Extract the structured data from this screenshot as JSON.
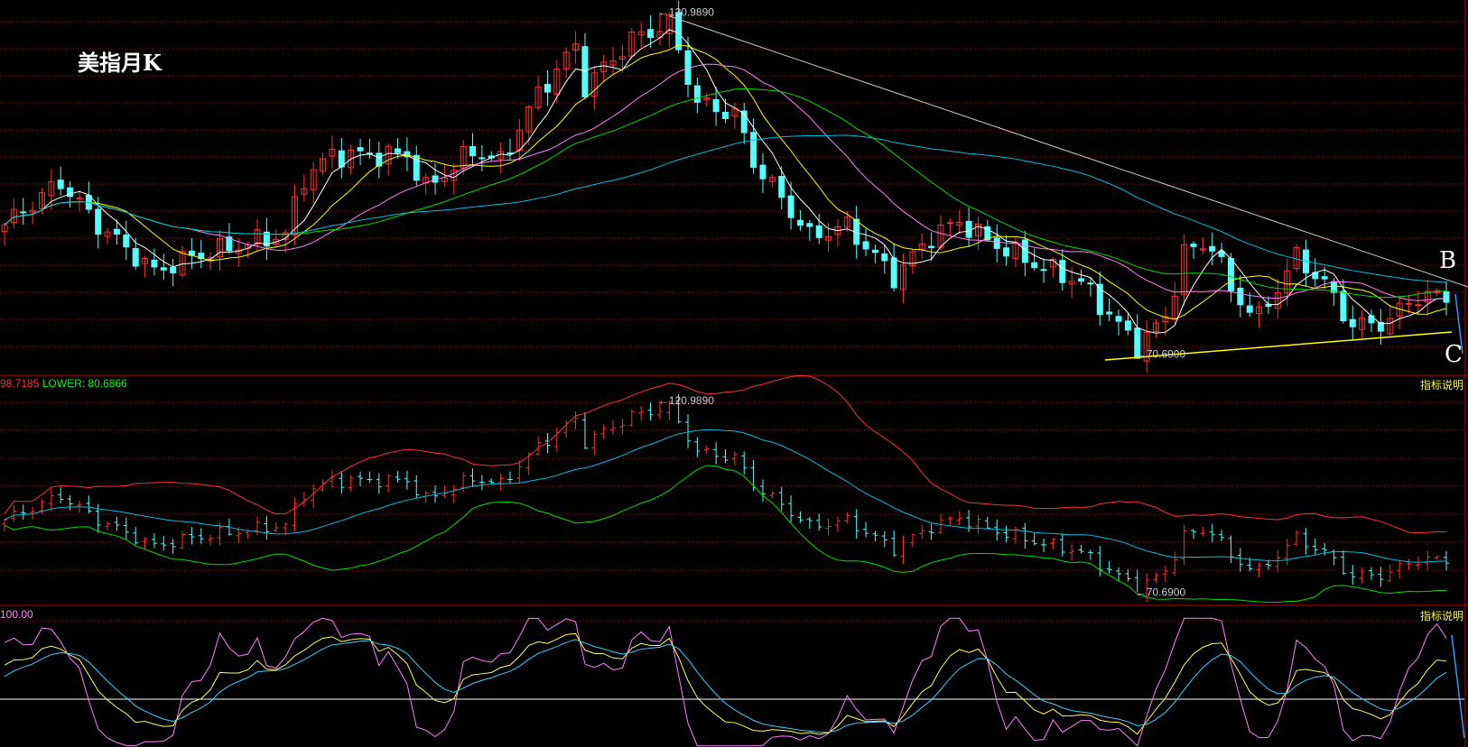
{
  "title": "美指月K",
  "help_label": "指标说明",
  "wave_labels": {
    "b": "B",
    "c": "C"
  },
  "boll_header": {
    "upper_value": "98.7185",
    "lower_text": "LOWER: 80.6866"
  },
  "kdj_header": {
    "top_value": "100.00"
  },
  "colors": {
    "up": "#ff3232",
    "down": "#54ffff",
    "ma5": "#ffffff",
    "ma10": "#ffff00",
    "ma20": "#ff80ff",
    "ma30": "#00e000",
    "ma60": "#00c0e0",
    "grid": "#c00000"
  },
  "chart_data": {
    "type": "candlestick",
    "title": "美指月K",
    "annotations": {
      "high": "120.9890",
      "low": "70.6900"
    },
    "high_value": 120.989,
    "low_value": 70.69,
    "high_index": 70,
    "low_index": 121,
    "candle_count": 155,
    "close_path": [
      [
        0,
        89.7
      ],
      [
        6,
        96
      ],
      [
        10,
        89.7
      ],
      [
        16,
        82.8
      ],
      [
        20,
        85
      ],
      [
        26,
        87
      ],
      [
        30,
        88.3
      ],
      [
        32,
        96.6
      ],
      [
        35,
        100
      ],
      [
        43,
        100
      ],
      [
        45,
        95
      ],
      [
        50,
        100.6
      ],
      [
        53,
        99
      ],
      [
        57,
        109
      ],
      [
        61,
        116
      ],
      [
        62,
        110
      ],
      [
        67,
        117
      ],
      [
        71,
        119.3
      ],
      [
        74,
        107.6
      ],
      [
        78,
        106
      ],
      [
        80,
        99
      ],
      [
        83,
        93.6
      ],
      [
        86,
        88
      ],
      [
        90,
        89.5
      ],
      [
        95,
        82
      ],
      [
        99,
        88
      ],
      [
        102,
        90.2
      ],
      [
        105,
        87.4
      ],
      [
        110,
        84
      ],
      [
        115,
        81.2
      ],
      [
        121,
        71.8
      ],
      [
        124,
        76
      ],
      [
        126,
        85.6
      ],
      [
        129,
        87
      ],
      [
        131,
        80
      ],
      [
        134,
        76
      ],
      [
        138,
        85
      ],
      [
        141,
        81
      ],
      [
        144,
        74.8
      ],
      [
        148,
        75.5
      ],
      [
        150,
        78.7
      ],
      [
        154,
        79.4
      ]
    ],
    "moving_averages": [
      5,
      10,
      20,
      30,
      60
    ],
    "indicators": [
      "BOLL",
      "KDJ"
    ]
  }
}
